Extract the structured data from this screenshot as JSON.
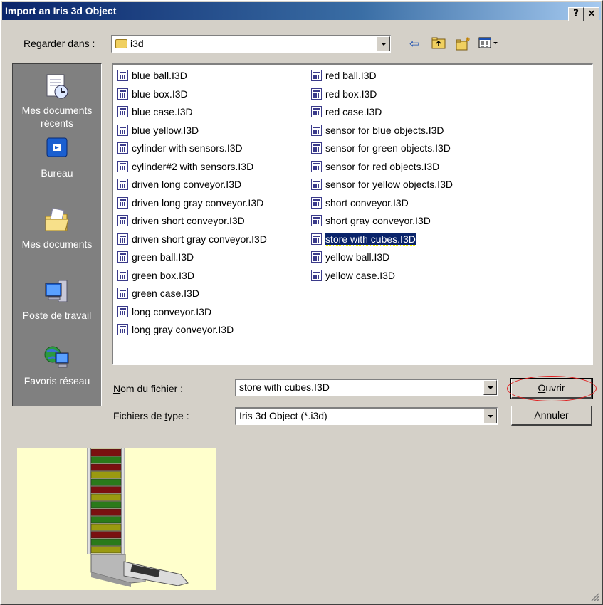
{
  "window": {
    "title": "Import an Iris 3d Object",
    "help_btn": "?",
    "close_btn": "×"
  },
  "lookin": {
    "label_pre": "Regarder ",
    "label_u": "d",
    "label_post": "ans :",
    "value": "i3d"
  },
  "places": [
    {
      "label": "Mes documents récents",
      "icon": "recent-documents-icon"
    },
    {
      "label": "Bureau",
      "icon": "desktop-icon"
    },
    {
      "label": "Mes documents",
      "icon": "my-documents-icon"
    },
    {
      "label": "Poste de travail",
      "icon": "my-computer-icon"
    },
    {
      "label": "Favoris réseau",
      "icon": "network-places-icon"
    }
  ],
  "files_col1": [
    "blue ball.I3D",
    "blue box.I3D",
    "blue case.I3D",
    "blue yellow.I3D",
    "cylinder with sensors.I3D",
    "cylinder#2 with sensors.I3D",
    "driven long conveyor.I3D",
    "driven long gray conveyor.I3D",
    "driven short conveyor.I3D",
    "driven short gray conveyor.I3D",
    "green ball.I3D",
    "green box.I3D",
    "green case.I3D",
    "long conveyor.I3D",
    "long gray conveyor.I3D"
  ],
  "files_col2": [
    "red ball.I3D",
    "red box.I3D",
    "red case.I3D",
    "sensor for blue objects.I3D",
    "sensor for green objects.I3D",
    "sensor for red objects.I3D",
    "sensor for yellow objects.I3D",
    "short conveyor.I3D",
    "short gray conveyor.I3D",
    "store with cubes.I3D",
    "yellow ball.I3D",
    "yellow case.I3D"
  ],
  "selected_file": "store with cubes.I3D",
  "filename": {
    "label_u": "N",
    "label_post": "om du fichier :",
    "value": "store with cubes.I3D"
  },
  "filetype": {
    "label_pre": "Fichiers de ",
    "label_u": "t",
    "label_post": "ype :",
    "value": "Iris 3d Object (*.i3d)"
  },
  "buttons": {
    "open_u": "O",
    "open_post": "uvrir",
    "cancel": "Annuler"
  }
}
